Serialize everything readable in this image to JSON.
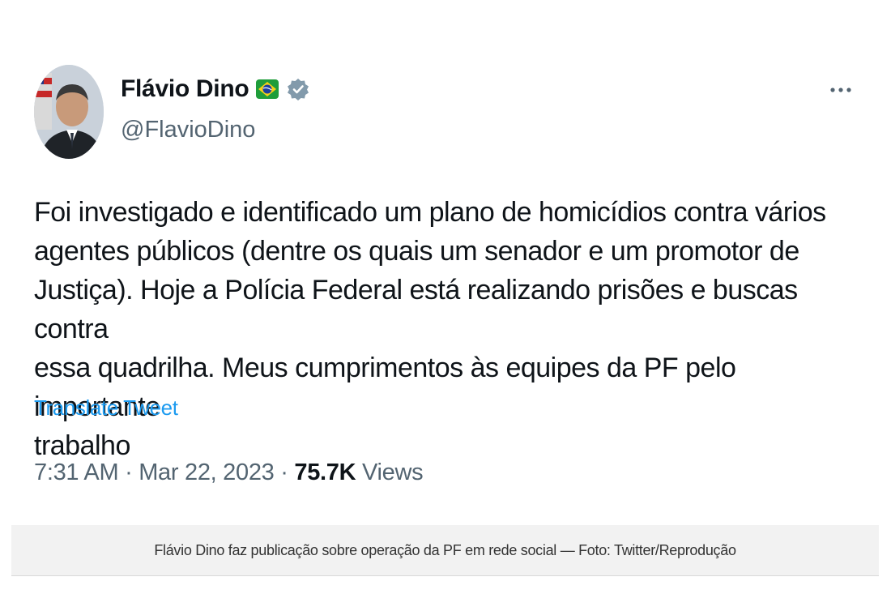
{
  "tweet": {
    "author_name": "Flávio Dino",
    "flag_icon": "brazil-flag-icon",
    "verified_icon": "verified-badge-icon",
    "handle": "@FlavioDino",
    "more_icon": "more-options-icon",
    "text": "Foi investigado e identificado um plano de homicídios contra vários\nagentes públicos (dentre os quais um senador e um promotor de\nJustiça). Hoje a Polícia Federal está realizando prisões e buscas contra\nessa quadrilha. Meus cumprimentos às equipes da PF pelo importante\ntrabalho",
    "translate_label": "Translate Tweet",
    "time": "7:31 AM",
    "date": "Mar 22, 2023",
    "separator": " · ",
    "views_count": "75.7K",
    "views_label": " Views"
  },
  "caption": "Flávio Dino faz publicação sobre operação da PF em rede social — Foto: Twitter/Reprodução",
  "colors": {
    "text": "#0f1419",
    "secondary": "#536471",
    "link": "#1d9bf0",
    "verified": "#829aab"
  }
}
